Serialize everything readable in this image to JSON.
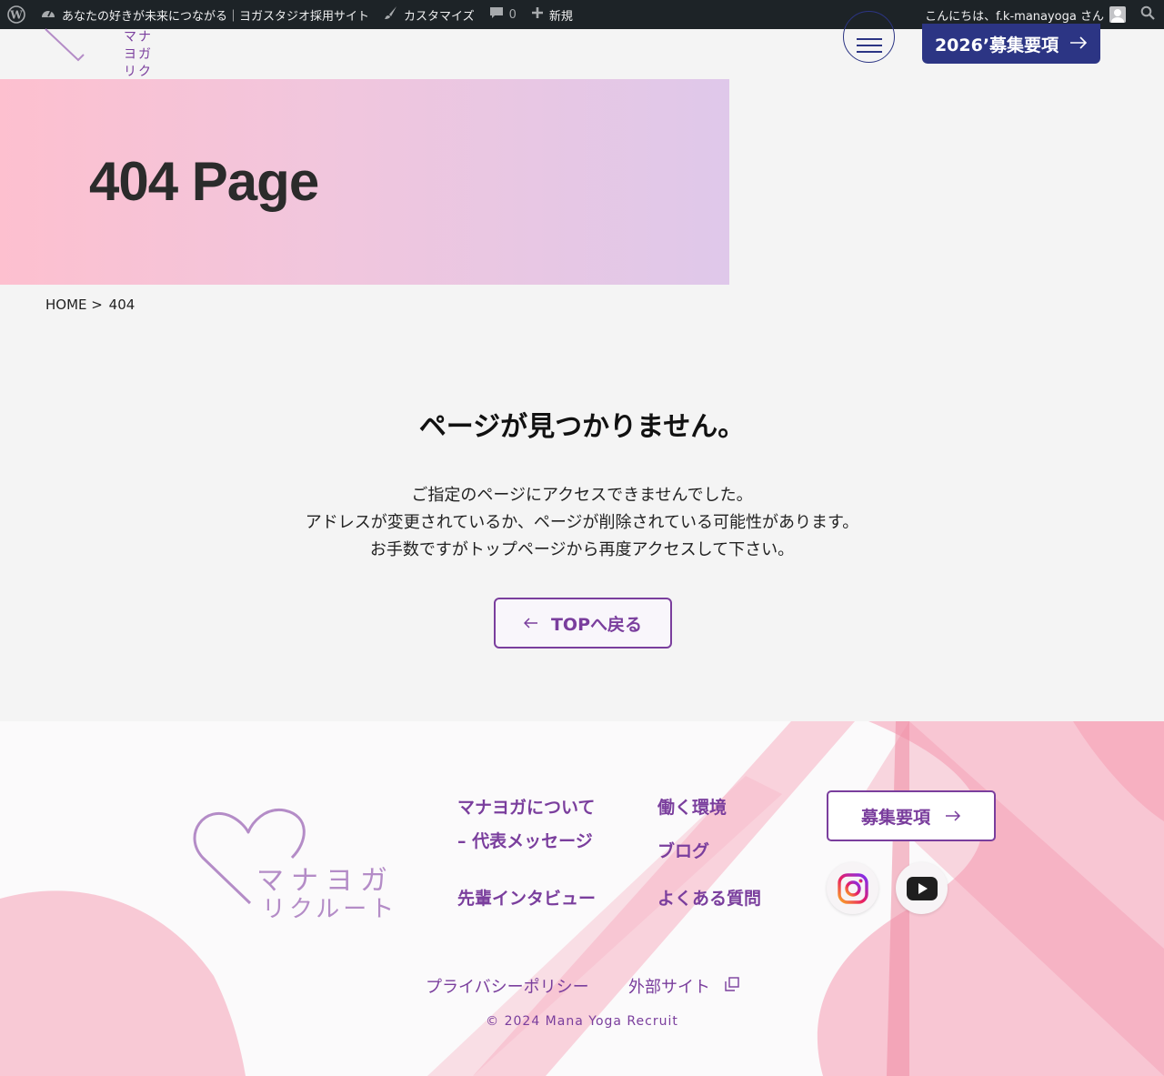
{
  "adminbar": {
    "site_name": "あなたの好きが未来につながる｜ヨガスタジオ採用サイト",
    "customize": "カスタマイズ",
    "comments_count": "0",
    "new": "新規",
    "greeting": "こんにちは、f.k-manayoga さん"
  },
  "header": {
    "logo_line1": "マナヨガ",
    "logo_line2": "リクルート",
    "cta": "2026’募集要項"
  },
  "hero": {
    "title": "404 Page"
  },
  "breadcrumb": {
    "home": "HOME",
    "sep": ">",
    "current": "404"
  },
  "not_found": {
    "title": "ページが見つかりません。",
    "line1": "ご指定のページにアクセスできませんでした。",
    "line2": "アドレスが変更されているか、ページが削除されている可能性があります。",
    "line3": "お手数ですがトップページから再度アクセスして下さい。",
    "back_button": "TOPへ戻る"
  },
  "footer": {
    "logo_line1": "マナヨガ",
    "logo_line2": "リクルート",
    "links": {
      "about": "マナヨガについて",
      "message": "– 代表メッセージ",
      "interview": "先輩インタビュー",
      "environment": "働く環境",
      "blog": "ブログ",
      "faq": "よくある質問"
    },
    "cta": "募集要項",
    "privacy": "プライバシーポリシー",
    "external": "外部サイト",
    "copyright": "© 2024 Mana Yoga Recruit"
  },
  "colors": {
    "accent_purple": "#7a3e9d",
    "navy": "#2c3584",
    "admin_bar": "#1d2327"
  }
}
